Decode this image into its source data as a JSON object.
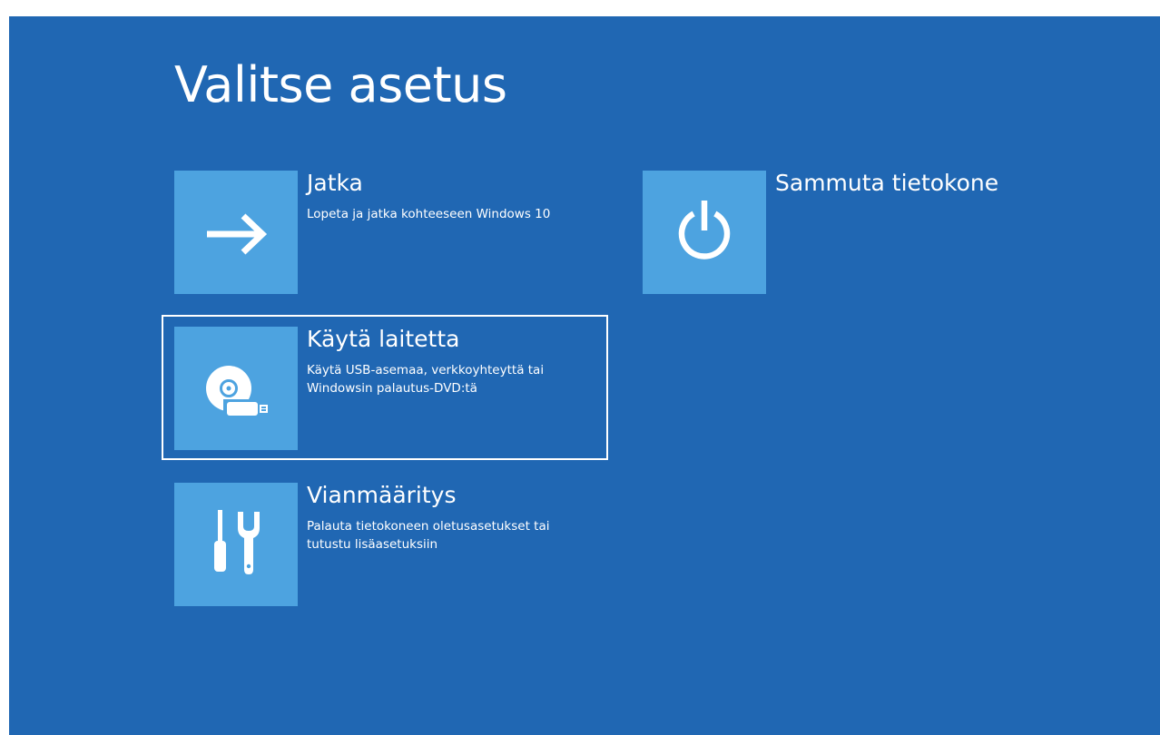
{
  "page": {
    "title": "Valitse asetus"
  },
  "options": [
    {
      "id": "continue",
      "title": "Jatka",
      "desc_lines": [
        "Lopeta ja jatka kohteeseen Windows 10"
      ],
      "icon": "arrow-right-icon"
    },
    {
      "id": "device",
      "title": "Käytä laitetta",
      "desc_lines": [
        "Käytä USB-asemaa, verkkoyhteyttä tai",
        "Windowsin palautus-DVD:tä"
      ],
      "icon": "disc-usb-icon",
      "focused": true
    },
    {
      "id": "troubleshoot",
      "title": "Vianmääritys",
      "desc_lines": [
        "Palauta tietokoneen oletusasetukset tai",
        "tutustu lisäasetuksiin"
      ],
      "icon": "tools-icon"
    },
    {
      "id": "shutdown",
      "title": "Sammuta tietokone",
      "desc_lines": [],
      "icon": "power-icon"
    }
  ],
  "colors": {
    "background": "#2067b3",
    "tile": "#4da3e0",
    "text": "#ffffff",
    "page_margin": "#ffffff"
  }
}
